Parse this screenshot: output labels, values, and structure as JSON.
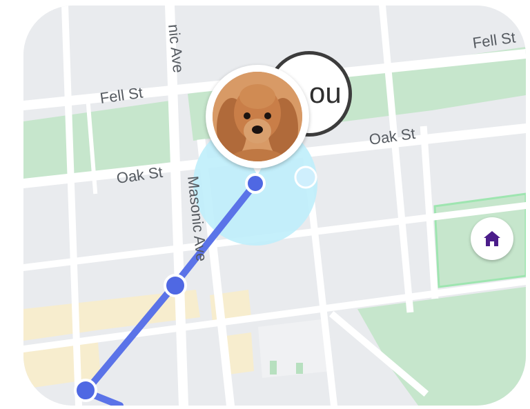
{
  "map": {
    "streets": [
      {
        "id": "fell-st-top-right",
        "label": "Fell St"
      },
      {
        "id": "fell-st-left",
        "label": "Fell St"
      },
      {
        "id": "oak-st-right",
        "label": "Oak St"
      },
      {
        "id": "oak-st-left",
        "label": "Oak St"
      },
      {
        "id": "masonic-ave-top",
        "label": "nic Ave"
      },
      {
        "id": "masonic-ave-mid",
        "label": "Masonic Ave"
      }
    ],
    "markers": {
      "you_label": "ou",
      "pet_icon": "dog-photo-icon",
      "home_icon": "home-icon"
    },
    "route": {
      "color": "#5b73e8",
      "waypoint_color": "#4f68e3"
    },
    "colors": {
      "park": "#c6e6cc",
      "home_zone": "#9ee5b0",
      "home_icon": "#4b1d8a",
      "accuracy_circle": "#bfeefb",
      "sand": "#f7edce"
    }
  }
}
